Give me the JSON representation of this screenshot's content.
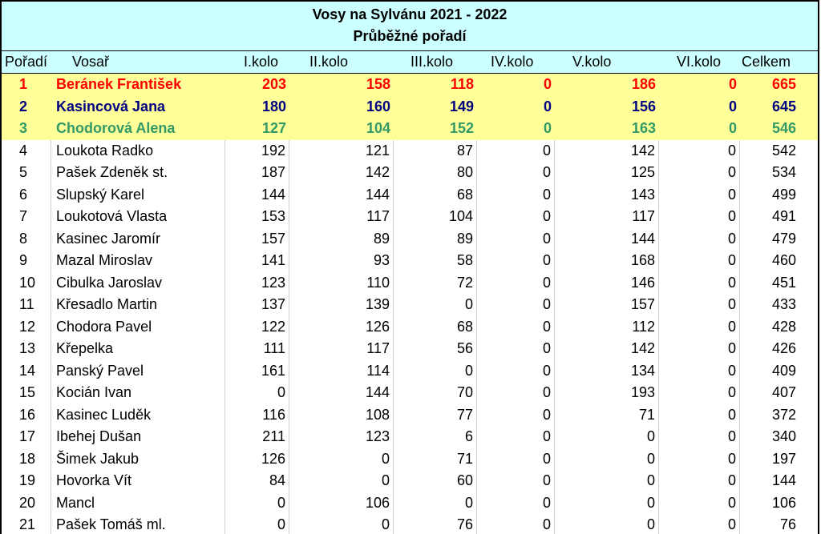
{
  "title": "Vosy na Sylvánu 2021 - 2022",
  "subtitle": "Průběžné pořadí",
  "columns": {
    "rank": "Pořadí",
    "name": "Vosař",
    "k1": "I.kolo",
    "k2": "II.kolo",
    "k3": "III.kolo",
    "k4": "IV.kolo",
    "k5": "V.kolo",
    "k6": "VI.kolo",
    "total": "Celkem"
  },
  "colors": {
    "header_bg": "#ccffff",
    "podium_bg": "#ffff99",
    "first": "#ff0000",
    "second": "#000080",
    "third": "#339966"
  },
  "rows": [
    {
      "rank": "1",
      "name": "Beránek František",
      "k1": "203",
      "k2": "158",
      "k3": "118",
      "k4": "0",
      "k5": "186",
      "k6": "0",
      "total": "665"
    },
    {
      "rank": "2",
      "name": "Kasincová Jana",
      "k1": "180",
      "k2": "160",
      "k3": "149",
      "k4": "0",
      "k5": "156",
      "k6": "0",
      "total": "645"
    },
    {
      "rank": "3",
      "name": "Chodorová Alena",
      "k1": "127",
      "k2": "104",
      "k3": "152",
      "k4": "0",
      "k5": "163",
      "k6": "0",
      "total": "546"
    },
    {
      "rank": "4",
      "name": "Loukota Radko",
      "k1": "192",
      "k2": "121",
      "k3": "87",
      "k4": "0",
      "k5": "142",
      "k6": "0",
      "total": "542"
    },
    {
      "rank": "5",
      "name": "Pašek Zdeněk st.",
      "k1": "187",
      "k2": "142",
      "k3": "80",
      "k4": "0",
      "k5": "125",
      "k6": "0",
      "total": "534"
    },
    {
      "rank": "6",
      "name": "Slupský Karel",
      "k1": "144",
      "k2": "144",
      "k3": "68",
      "k4": "0",
      "k5": "143",
      "k6": "0",
      "total": "499"
    },
    {
      "rank": "7",
      "name": "Loukotová Vlasta",
      "k1": "153",
      "k2": "117",
      "k3": "104",
      "k4": "0",
      "k5": "117",
      "k6": "0",
      "total": "491"
    },
    {
      "rank": "8",
      "name": "Kasinec Jaromír",
      "k1": "157",
      "k2": "89",
      "k3": "89",
      "k4": "0",
      "k5": "144",
      "k6": "0",
      "total": "479"
    },
    {
      "rank": "9",
      "name": "Mazal Miroslav",
      "k1": "141",
      "k2": "93",
      "k3": "58",
      "k4": "0",
      "k5": "168",
      "k6": "0",
      "total": "460"
    },
    {
      "rank": "10",
      "name": "Cibulka Jaroslav",
      "k1": "123",
      "k2": "110",
      "k3": "72",
      "k4": "0",
      "k5": "146",
      "k6": "0",
      "total": "451"
    },
    {
      "rank": "11",
      "name": "Křesadlo Martin",
      "k1": "137",
      "k2": "139",
      "k3": "0",
      "k4": "0",
      "k5": "157",
      "k6": "0",
      "total": "433"
    },
    {
      "rank": "12",
      "name": "Chodora Pavel",
      "k1": "122",
      "k2": "126",
      "k3": "68",
      "k4": "0",
      "k5": "112",
      "k6": "0",
      "total": "428"
    },
    {
      "rank": "13",
      "name": "Křepelka",
      "k1": "111",
      "k2": "117",
      "k3": "56",
      "k4": "0",
      "k5": "142",
      "k6": "0",
      "total": "426"
    },
    {
      "rank": "14",
      "name": "Panský Pavel",
      "k1": "161",
      "k2": "114",
      "k3": "0",
      "k4": "0",
      "k5": "134",
      "k6": "0",
      "total": "409"
    },
    {
      "rank": "15",
      "name": "Kocián Ivan",
      "k1": "0",
      "k2": "144",
      "k3": "70",
      "k4": "0",
      "k5": "193",
      "k6": "0",
      "total": "407"
    },
    {
      "rank": "16",
      "name": "Kasinec Luděk",
      "k1": "116",
      "k2": "108",
      "k3": "77",
      "k4": "0",
      "k5": "71",
      "k6": "0",
      "total": "372"
    },
    {
      "rank": "17",
      "name": "Ibehej Dušan",
      "k1": "211",
      "k2": "123",
      "k3": "6",
      "k4": "0",
      "k5": "0",
      "k6": "0",
      "total": "340"
    },
    {
      "rank": "18",
      "name": "Šimek Jakub",
      "k1": "126",
      "k2": "0",
      "k3": "71",
      "k4": "0",
      "k5": "0",
      "k6": "0",
      "total": "197"
    },
    {
      "rank": "19",
      "name": "Hovorka Vít",
      "k1": "84",
      "k2": "0",
      "k3": "60",
      "k4": "0",
      "k5": "0",
      "k6": "0",
      "total": "144"
    },
    {
      "rank": "20",
      "name": "Mancl",
      "k1": "0",
      "k2": "106",
      "k3": "0",
      "k4": "0",
      "k5": "0",
      "k6": "0",
      "total": "106"
    },
    {
      "rank": "21",
      "name": "Pašek Tomáš ml.",
      "k1": "0",
      "k2": "0",
      "k3": "76",
      "k4": "0",
      "k5": "0",
      "k6": "0",
      "total": "76"
    }
  ]
}
